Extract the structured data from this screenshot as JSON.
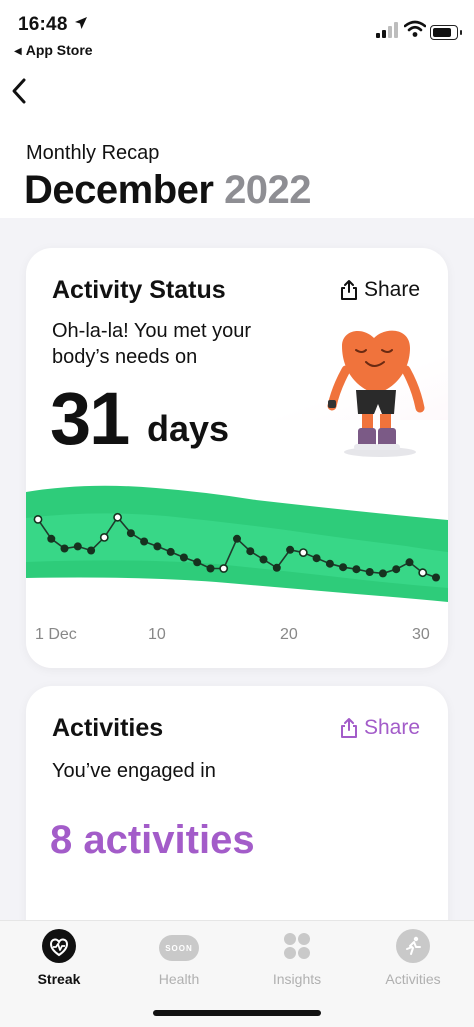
{
  "status_bar": {
    "time": "16:48",
    "back_app": "App Store"
  },
  "header": {
    "subtitle": "Monthly Recap",
    "month": "December",
    "year": "2022"
  },
  "activity_card": {
    "title": "Activity Status",
    "share_label": "Share",
    "message": "Oh-la-la! You met your body’s needs on",
    "days_number": "31",
    "days_word": "days",
    "x_labels": [
      "1 Dec",
      "10",
      "20",
      "30"
    ]
  },
  "activities_card": {
    "title": "Activities",
    "share_label": "Share",
    "message": "You’ve engaged in",
    "count_text": "8 activities"
  },
  "tabs": [
    {
      "label": "Streak",
      "icon": "streak-icon",
      "active": true
    },
    {
      "label": "Health",
      "icon": "soon-badge-icon",
      "badge": "SOON",
      "active": false
    },
    {
      "label": "Insights",
      "icon": "grid-icon",
      "active": false
    },
    {
      "label": "Activities",
      "icon": "running-icon",
      "active": false
    }
  ],
  "colors": {
    "accent_purple": "#a35cc9",
    "chart_green_dark": "#2ecc7a",
    "chart_green_light": "#3ad88a",
    "year_gray": "#8e8e93"
  },
  "chart_data": {
    "type": "line",
    "x": [
      1,
      2,
      3,
      4,
      5,
      6,
      7,
      8,
      9,
      10,
      11,
      12,
      13,
      14,
      15,
      16,
      17,
      18,
      19,
      20,
      21,
      22,
      23,
      24,
      25,
      26,
      27,
      28,
      29,
      30,
      31
    ],
    "values": [
      0.72,
      0.44,
      0.3,
      0.33,
      0.27,
      0.46,
      0.75,
      0.52,
      0.4,
      0.33,
      0.25,
      0.17,
      0.1,
      0.01,
      0.01,
      0.44,
      0.26,
      0.14,
      0.02,
      0.28,
      0.24,
      0.16,
      0.08,
      0.03,
      0.0,
      -0.04,
      -0.06,
      0.0,
      0.1,
      -0.05,
      -0.12
    ],
    "open_points": [
      1,
      6,
      7,
      15,
      21,
      30
    ],
    "ylim": [
      -0.3,
      1.0
    ],
    "grid": false
  }
}
